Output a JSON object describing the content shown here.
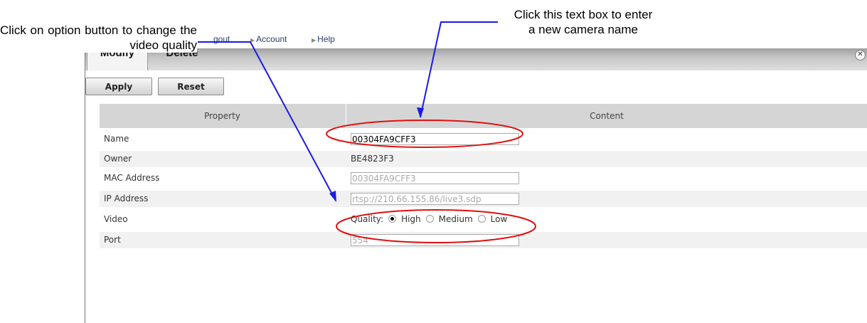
{
  "annotations": {
    "left": "Click on option button to change the video quality",
    "right_line1": "Click this text box to enter",
    "right_line2": "a new camera name"
  },
  "topnav": {
    "logout": "gout",
    "account": "Account",
    "help": "Help"
  },
  "tabs": {
    "modify": "Modify",
    "delete": "Delete"
  },
  "toolbar": {
    "apply": "Apply",
    "reset": "Reset"
  },
  "table": {
    "headers": {
      "property": "Property",
      "content": "Content"
    },
    "rows": {
      "name": {
        "label": "Name",
        "value": "00304FA9CFF3"
      },
      "owner": {
        "label": "Owner",
        "value": "BE4823F3"
      },
      "mac": {
        "label": "MAC Address",
        "value": "00304FA9CFF3"
      },
      "ip": {
        "label": "IP Address",
        "value": "rtsp://210.66.155.86/live3.sdp"
      },
      "video": {
        "label": "Video",
        "quality_label": "Quality:",
        "options": [
          "High",
          "Medium",
          "Low"
        ],
        "selected": "High"
      },
      "port": {
        "label": "Port",
        "value": "554"
      }
    }
  },
  "colors": {
    "annotation_arrow": "#1a1ae6",
    "highlight_ellipse": "#e01010",
    "tabbar": "#c0c0c0",
    "header_row": "#d5d5d5"
  },
  "icons": {
    "close": "close-icon",
    "nav_bullet": "triangle-right-icon"
  }
}
